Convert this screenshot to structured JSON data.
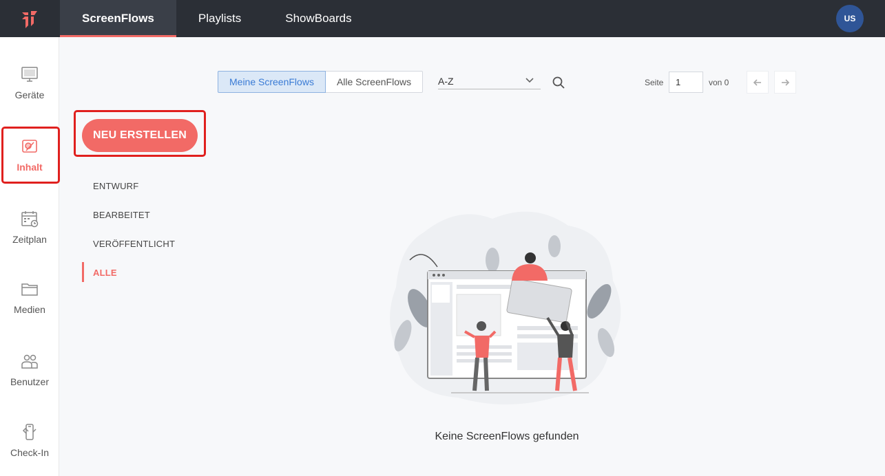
{
  "header": {
    "tabs": [
      {
        "label": "ScreenFlows",
        "active": true
      },
      {
        "label": "Playlists",
        "active": false
      },
      {
        "label": "ShowBoards",
        "active": false
      }
    ],
    "avatar_initials": "US"
  },
  "sidebar": {
    "items": [
      {
        "label": "Geräte",
        "icon": "monitor-icon"
      },
      {
        "label": "Inhalt",
        "icon": "content-icon",
        "active": true
      },
      {
        "label": "Zeitplan",
        "icon": "calendar-icon"
      },
      {
        "label": "Medien",
        "icon": "folder-icon"
      },
      {
        "label": "Benutzer",
        "icon": "users-icon"
      },
      {
        "label": "Check-In",
        "icon": "checkin-icon"
      }
    ]
  },
  "toolbar": {
    "scope_options": [
      "Meine ScreenFlows",
      "Alle ScreenFlows"
    ],
    "scope_selected": "Meine ScreenFlows",
    "sort_value": "A-Z",
    "pagination": {
      "page_label": "Seite",
      "page_value": "1",
      "of_label": "von 0"
    }
  },
  "create_button": "NEU ERSTELLEN",
  "filters": [
    {
      "label": "ENTWURF"
    },
    {
      "label": "BEARBEITET"
    },
    {
      "label": "VERÖFFENTLICHT"
    },
    {
      "label": "ALLE",
      "active": true
    }
  ],
  "empty_state": {
    "message": "Keine ScreenFlows gefunden"
  },
  "colors": {
    "accent": "#f26a66",
    "topbar": "#2b2f36",
    "avatar": "#2f5597",
    "highlight": "#e0201e",
    "selected_blue": "#3a7bd5"
  }
}
